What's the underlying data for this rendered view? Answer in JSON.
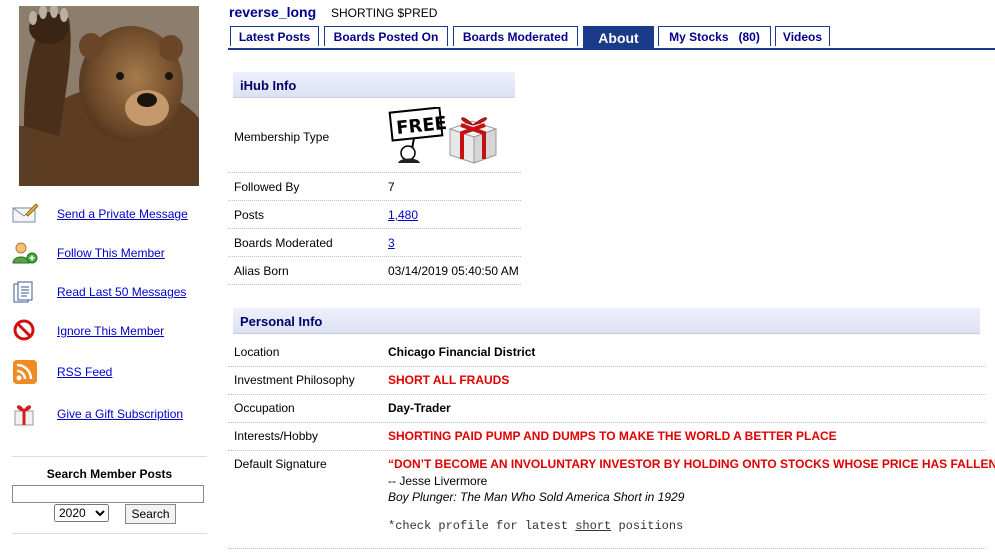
{
  "profile": {
    "username": "reverse_long",
    "tagline": "SHORTING $PRED"
  },
  "tabs": [
    {
      "label": "Latest Posts"
    },
    {
      "label": "Boards Posted On"
    },
    {
      "label": "Boards Moderated"
    },
    {
      "label": "About"
    },
    {
      "label": "My Stocks   (80)"
    },
    {
      "label": "Videos"
    }
  ],
  "active_tab": "About",
  "actions": [
    {
      "label": "Send a Private Message",
      "icon": "envelope-pencil-icon"
    },
    {
      "label": "Follow This Member",
      "icon": "add-user-icon"
    },
    {
      "label": "Read Last 50 Messages",
      "icon": "documents-icon"
    },
    {
      "label": "Ignore This Member",
      "icon": "no-entry-icon"
    },
    {
      "label": "RSS Feed",
      "icon": "rss-icon"
    },
    {
      "label": "Give a Gift Subscription",
      "icon": "gift-icon"
    }
  ],
  "search": {
    "title": "Search Member Posts",
    "year": "2020",
    "button": "Search",
    "value": ""
  },
  "ihub_info": {
    "title": "iHub Info",
    "rows": [
      {
        "label": "Membership Type",
        "value": ""
      },
      {
        "label": "Followed By",
        "value": "7"
      },
      {
        "label": "Posts",
        "value": "1,480"
      },
      {
        "label": "Boards Moderated",
        "value": "3"
      },
      {
        "label": "Alias Born",
        "value": "03/14/2019 05:40:50 AM"
      }
    ],
    "badge_free_text": "FREE"
  },
  "personal_info": {
    "title": "Personal Info",
    "rows": [
      {
        "label": "Location",
        "value": "Chicago Financial District"
      },
      {
        "label": "Investment Philosophy",
        "value": "SHORT ALL FRAUDS"
      },
      {
        "label": "Occupation",
        "value": "Day-Trader"
      },
      {
        "label": "Interests/Hobby",
        "value": "SHORTING PAID PUMP AND DUMPS TO MAKE THE WORLD A BETTER PLACE"
      },
      {
        "label": "Default Signature",
        "value": "“DON’T BECOME AN INVOLUNTARY INVESTOR BY HOLDING ONTO STOCKS WHOSE PRICE HAS FALLEN”"
      }
    ],
    "signature": {
      "author": "-- Jesse Livermore",
      "book": "Boy Plunger: The Man Who Sold America Short in 1929",
      "note_prefix": "*check profile for latest ",
      "note_link": "short",
      "note_suffix": " positions"
    }
  },
  "colors": {
    "accent": "#1a3a8a",
    "red": "#e00000",
    "link": "#0000cc"
  }
}
